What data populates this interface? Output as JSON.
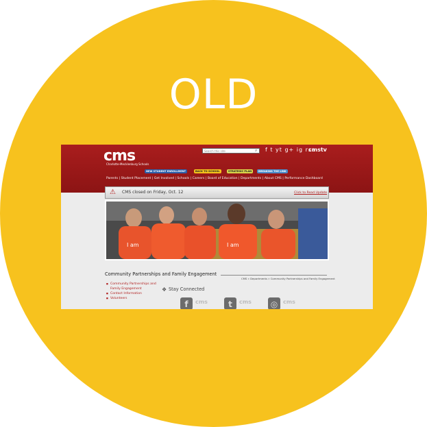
{
  "badge": "OLD",
  "site": {
    "logo": "cms",
    "logo_sub": "Charlotte-Mecklenburg Schools",
    "search_placeholder": "Search this site",
    "social_icons": "f t yt g+ ig rss",
    "cmstv": "cmstv",
    "pills": [
      {
        "label": "NEW STUDENT ENROLLMENT",
        "bg": "#2c5ea8",
        "color": "#ffffff"
      },
      {
        "label": "BACK TO SCHOOL",
        "bg": "#f3c21c",
        "color": "#222222"
      },
      {
        "label": "STRATEGIC PLAN",
        "bg": "#d9d34a",
        "color": "#222222"
      },
      {
        "label": "BREAKING THE LINK",
        "bg": "#4a8ac8",
        "color": "#ffffff"
      }
    ],
    "nav": [
      "Parents",
      "Student Placement",
      "Get Involved",
      "Schools",
      "Careers",
      "Board of Education",
      "Departments",
      "About CMS",
      "Performance Dashboard"
    ],
    "alert": {
      "text": "CMS closed on Friday, Oct. 12",
      "link": "Click to Read Update"
    },
    "section_title": "Community Partnerships and Family Engagement",
    "breadcrumb": "CMS » Departments » Community Partnerships and Family Engagement",
    "sidebar": [
      "Community Partnerships and Family Engagement",
      "Contact Information",
      "Volunteers"
    ],
    "stay_connected": "Stay Connected",
    "social_boxes": [
      {
        "icon": "facebook-icon",
        "glyph": "f",
        "label": "cms"
      },
      {
        "icon": "twitter-icon",
        "glyph": "t",
        "label": "cms"
      },
      {
        "icon": "instagram-icon",
        "glyph": "◎",
        "label": "cms"
      }
    ]
  },
  "colors": {
    "circle": "#F7C21E",
    "header": "#9e1a1a",
    "accent": "#b01e1e"
  }
}
